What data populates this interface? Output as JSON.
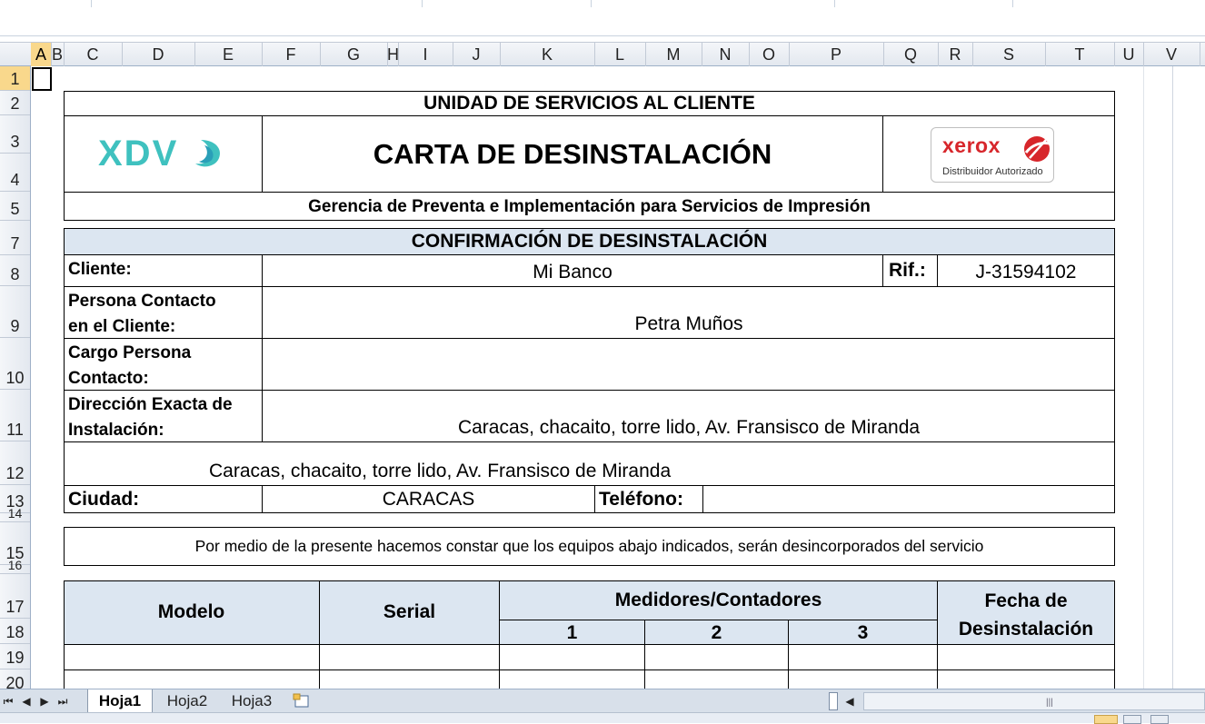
{
  "columns": [
    "A",
    "B",
    "C",
    "D",
    "E",
    "F",
    "G",
    "H",
    "I",
    "J",
    "K",
    "L",
    "M",
    "N",
    "O",
    "P",
    "Q",
    "R",
    "S",
    "T",
    "U",
    "V"
  ],
  "rows": [
    "1",
    "2",
    "3",
    "4",
    "5",
    "7",
    "8",
    "9",
    "10",
    "11",
    "12",
    "13",
    "14",
    "15",
    "16",
    "17",
    "18",
    "19",
    "20"
  ],
  "form": {
    "header_title": "UNIDAD DE SERVICIOS AL CLIENTE",
    "logo_left": "XDV",
    "main_title": "CARTA DE DESINSTALACIÓN",
    "logo_right_brand": "xerox",
    "logo_right_caption": "Distribuidor Autorizado",
    "subtitle": "Gerencia de Preventa e Implementación para Servicios de Impresión",
    "section_title": "CONFIRMACIÓN DE DESINSTALACIÓN",
    "cliente_label": "Cliente:",
    "cliente_value": "Mi Banco",
    "rif_label": "Rif.:",
    "rif_value": "J-31594102",
    "persona_label_1": "Persona Contacto",
    "persona_label_2": "en el Cliente:",
    "persona_value": "Petra Muños",
    "cargo_label_1": "Cargo Persona",
    "cargo_label_2": "Contacto:",
    "cargo_value": "",
    "direccion_label_1": "Dirección Exacta de",
    "direccion_label_2": "Instalación:",
    "direccion_value": "Caracas, chacaito, torre lido, Av. Fransisco de Miranda",
    "direccion_value_2": "Caracas, chacaito, torre lido, Av. Fransisco de Miranda",
    "ciudad_label": "Ciudad:",
    "ciudad_value": "CARACAS",
    "telefono_label": "Teléfono:",
    "telefono_value": "",
    "statement": "Por medio de la presente hacemos constar que los equipos abajo indicados, serán desincorporados del servicio",
    "table": {
      "modelo": "Modelo",
      "serial": "Serial",
      "medidores": "Medidores/Contadores",
      "m1": "1",
      "m2": "2",
      "m3": "3",
      "fecha_1": "Fecha de",
      "fecha_2": "Desinstalación"
    }
  },
  "sheet_tabs": [
    "Hoja1",
    "Hoja2",
    "Hoja3"
  ],
  "active_sheet": "Hoja1",
  "colors": {
    "header_fill": "#dce6f1",
    "xdv_teal": "#3fc1bf",
    "xerox_red": "#d7262b",
    "selected_header": "#f9d88c"
  }
}
